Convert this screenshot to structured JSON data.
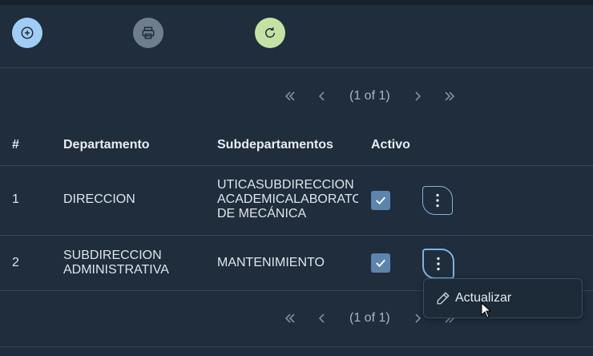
{
  "toolbar": {
    "add_icon": "plus-circle-icon",
    "print_icon": "printer-icon",
    "refresh_icon": "refresh-icon",
    "colors": {
      "add": "#9fcdf5",
      "print": "#6e7e8c",
      "refresh": "#c6e1a4"
    }
  },
  "paginator_top": {
    "page_report": "(1 of 1)"
  },
  "paginator_bottom": {
    "page_report": "(1 of 1)"
  },
  "table": {
    "headers": {
      "num": "#",
      "departamento": "Departamento",
      "subdepartamentos": "Subdepartamentos",
      "activo": "Activo"
    },
    "rows": [
      {
        "num": "1",
        "departamento": "DIRECCION",
        "sub_lines": [
          "UTICASUBDIRECCION",
          "ACADEMICALABORATO",
          "DE MECÁNICA"
        ],
        "activo": true
      },
      {
        "num": "2",
        "dep_lines": [
          "SUBDIRECCION",
          "ADMINISTRATIVA"
        ],
        "subdepartamentos": "MANTENIMIENTO",
        "activo": true
      }
    ]
  },
  "menu": {
    "items": [
      {
        "label": "Actualizar",
        "icon": "pencil-icon"
      }
    ]
  },
  "colors": {
    "background": "#1f2d3d",
    "checkbox": "#5d84ad",
    "accent_border": "#7fb2e3"
  }
}
